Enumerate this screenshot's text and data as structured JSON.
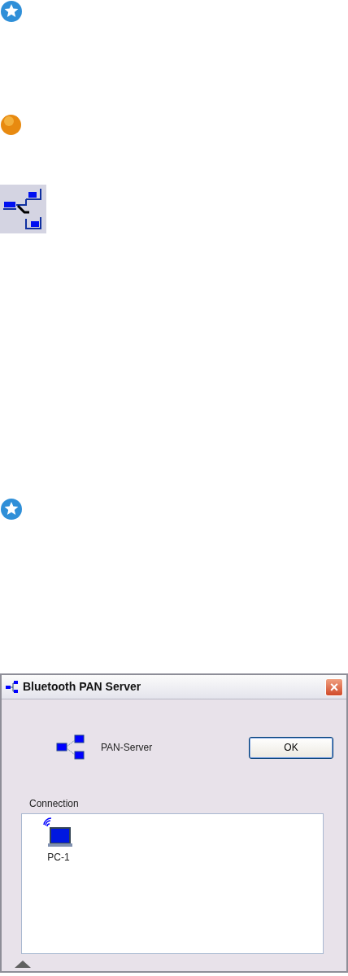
{
  "window": {
    "title": "Bluetooth PAN Server",
    "close": "×"
  },
  "server": {
    "name": "PAN-Server"
  },
  "buttons": [
    {
      "label": "OK"
    }
  ],
  "connection": {
    "label": "Connection",
    "devices": [
      {
        "label": "PC-1"
      }
    ]
  }
}
